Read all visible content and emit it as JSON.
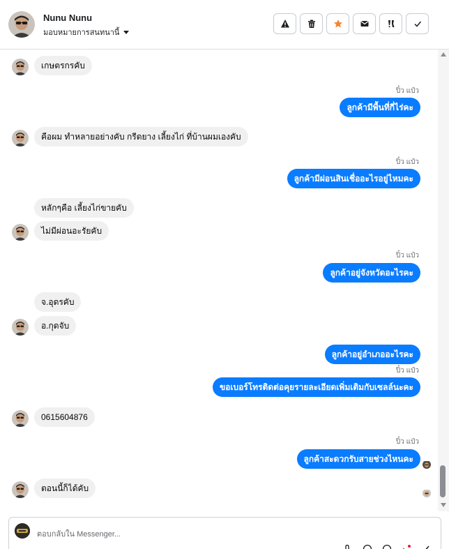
{
  "header": {
    "contact_name": "Nunu Nunu",
    "assign_label": "มอบหมายการสนทนานี้",
    "actions": [
      {
        "name": "spam-icon"
      },
      {
        "name": "trash-icon"
      },
      {
        "name": "star-icon",
        "color": "#f5862e"
      },
      {
        "name": "mail-icon"
      },
      {
        "name": "follow-up-icon"
      },
      {
        "name": "check-icon"
      }
    ]
  },
  "messages": [
    {
      "dir": "in",
      "text": "เกษตรกรคับ"
    },
    {
      "dir": "out",
      "sender": "ปิ๋ว แป๋ว",
      "text": "ลูกค้ามีพื้นที่กี่ไร่คะ"
    },
    {
      "dir": "in",
      "text": "คือผม ทำหลายอย่างคับ กรีดยาง เลี้ยงไก่ ที่บ้านผมเองคับ"
    },
    {
      "dir": "out",
      "sender": "ปิ๋ว แป๋ว",
      "text": "ลูกค้ามีผ่อนสินเชื่ออะไรอยู่ไหมคะ"
    },
    {
      "dir": "in",
      "text": "หลักๆคือ เลี้ยงไก่ขายคับ"
    },
    {
      "dir": "in",
      "text": "ไม่มีผ่อนอะรัยคับ"
    },
    {
      "dir": "out",
      "sender": "ปิ๋ว แป๋ว",
      "text": "ลูกค้าอยู่จังหวัดอะไรคะ"
    },
    {
      "dir": "in",
      "text": "จ.อุดรคับ"
    },
    {
      "dir": "in",
      "text": "อ.กุดจับ"
    },
    {
      "dir": "out",
      "text": "ลูกค้าอยู่อำเภออะไรคะ"
    },
    {
      "dir": "out",
      "sender": "ปิ๋ว แป๋ว",
      "text": "ขอเบอร์โทรติดต่อคุยรายละเอียดเพิ่มเติมกับเซลล์นะคะ"
    },
    {
      "dir": "in",
      "text": "0615604876"
    },
    {
      "dir": "out",
      "sender": "ปิ๋ว แป๋ว",
      "text": "ลูกค้าสะดวกรับสายช่วงไหนคะ"
    },
    {
      "dir": "in",
      "text": "ตอนนี้ก็ได้คับ"
    }
  ],
  "composer": {
    "placeholder": "ตอบกลับใน Messenger..."
  },
  "colors": {
    "outgoing_bubble": "#0a7cff",
    "incoming_bubble": "#f0f0f0",
    "accent_star": "#f5862e"
  }
}
